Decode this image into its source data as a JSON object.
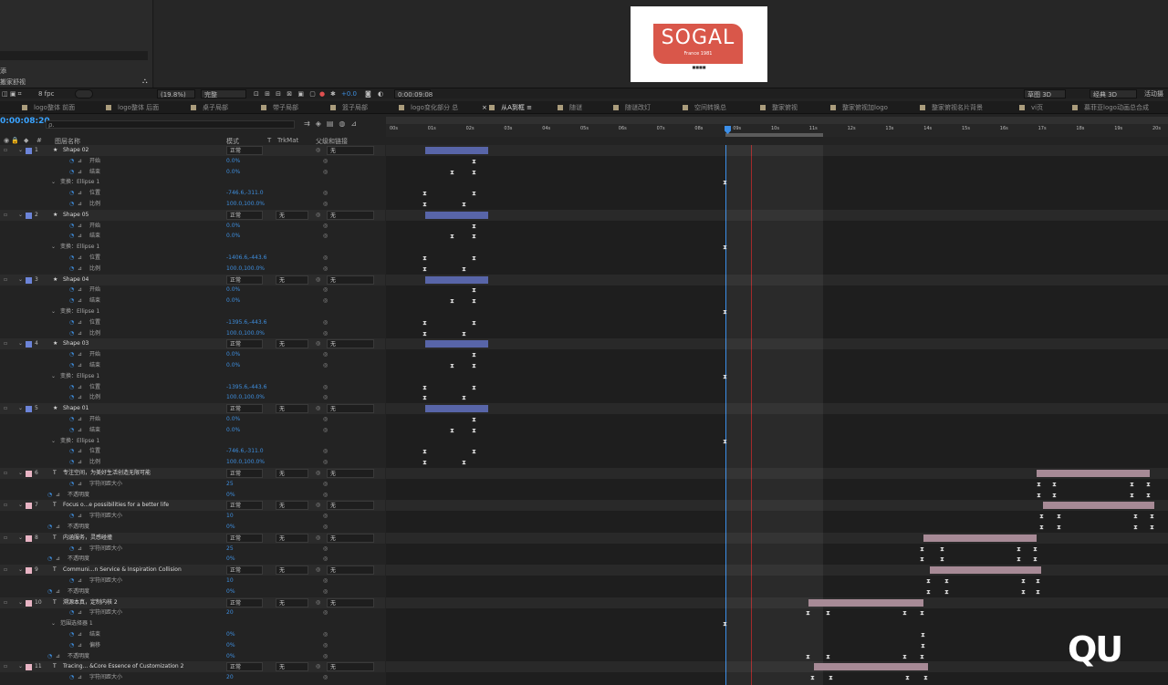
{
  "top_left": {
    "label1": "添",
    "label2": "搬家舒视"
  },
  "viewer": {
    "logo_main": "SOGAL",
    "logo_sub": "France 1981",
    "logo_tiny": "■■■■"
  },
  "controls": {
    "fps": "8 fpc",
    "zoom": "(19.8%)",
    "quality": "完整",
    "exposure": "+0.0",
    "timecode_small": "0:00:09:08",
    "render3d": "草图 3D",
    "mode": "经典 3D",
    "motion": "活动摄"
  },
  "tabs": [
    "logo整体 前面",
    "logo整体 后面",
    "桌子局部",
    "带子局部",
    "篮子局部",
    "logo变化部分 总",
    "从A到框",
    "随谜",
    "随谜改灯",
    "空间转换总",
    "整家俯视",
    "整家俯视加logo",
    "整家俯视名片背景",
    "vi页",
    "慕菲亚logo动画总合成"
  ],
  "active_tab": "从A到框",
  "timecode": "0:00:08:20",
  "columns": {
    "num": "#",
    "name": "图层名称",
    "mode": "模式",
    "t": "T",
    "trkmat": "TrkMat",
    "parent": "父级和链接"
  },
  "ruler_ticks": [
    "00s",
    "01s",
    "02s",
    "03s",
    "04s",
    "05s",
    "06s",
    "07s",
    "08s",
    "09s",
    "10s",
    "11s",
    "12s",
    "13s",
    "14s",
    "15s",
    "16s",
    "17s",
    "18s",
    "19s",
    "20s"
  ],
  "rows": [
    {
      "kind": "layer",
      "num": "1",
      "name": "Shape 02",
      "mode": "正常",
      "parent": "无",
      "color": "#6c84d8"
    },
    {
      "kind": "prop",
      "name": "开始",
      "value": "0.0%",
      "indent": 1
    },
    {
      "kind": "prop",
      "name": "结束",
      "value": "0.0%",
      "indent": 1
    },
    {
      "kind": "group",
      "name": "变换：Ellipse 1"
    },
    {
      "kind": "prop",
      "name": "位置",
      "value": "-746.6,-311.0",
      "indent": 1
    },
    {
      "kind": "prop",
      "name": "比例",
      "value": "100.0,100.0%",
      "indent": 1
    },
    {
      "kind": "layer",
      "num": "2",
      "name": "Shape 05",
      "mode": "正常",
      "trk": "无",
      "parent": "无",
      "color": "#6c84d8"
    },
    {
      "kind": "prop",
      "name": "开始",
      "value": "0.0%",
      "indent": 1
    },
    {
      "kind": "prop",
      "name": "结束",
      "value": "0.0%",
      "indent": 1
    },
    {
      "kind": "group",
      "name": "变换：Ellipse 1"
    },
    {
      "kind": "prop",
      "name": "位置",
      "value": "-1406.6,-443.6",
      "indent": 1
    },
    {
      "kind": "prop",
      "name": "比例",
      "value": "100.0,100.0%",
      "indent": 1
    },
    {
      "kind": "layer",
      "num": "3",
      "name": "Shape 04",
      "mode": "正常",
      "trk": "无",
      "parent": "无",
      "color": "#6c84d8"
    },
    {
      "kind": "prop",
      "name": "开始",
      "value": "0.0%",
      "indent": 1
    },
    {
      "kind": "prop",
      "name": "结束",
      "value": "0.0%",
      "indent": 1
    },
    {
      "kind": "group",
      "name": "变换：Ellipse 1"
    },
    {
      "kind": "prop",
      "name": "位置",
      "value": "-1395.6,-443.6",
      "indent": 1
    },
    {
      "kind": "prop",
      "name": "比例",
      "value": "100.0,100.0%",
      "indent": 1
    },
    {
      "kind": "layer",
      "num": "4",
      "name": "Shape 03",
      "mode": "正常",
      "trk": "无",
      "parent": "无",
      "color": "#6c84d8"
    },
    {
      "kind": "prop",
      "name": "开始",
      "value": "0.0%",
      "indent": 1
    },
    {
      "kind": "prop",
      "name": "结束",
      "value": "0.0%",
      "indent": 1
    },
    {
      "kind": "group",
      "name": "变换：Ellipse 1"
    },
    {
      "kind": "prop",
      "name": "位置",
      "value": "-1395.6,-443.6",
      "indent": 1
    },
    {
      "kind": "prop",
      "name": "比例",
      "value": "100.0,100.0%",
      "indent": 1
    },
    {
      "kind": "layer",
      "num": "5",
      "name": "Shape 01",
      "mode": "正常",
      "trk": "无",
      "parent": "无",
      "color": "#6c84d8"
    },
    {
      "kind": "prop",
      "name": "开始",
      "value": "0.0%",
      "indent": 1
    },
    {
      "kind": "prop",
      "name": "结束",
      "value": "0.0%",
      "indent": 1
    },
    {
      "kind": "group",
      "name": "变换：Ellipse 1"
    },
    {
      "kind": "prop",
      "name": "位置",
      "value": "-746.6,-311.0",
      "indent": 1
    },
    {
      "kind": "prop",
      "name": "比例",
      "value": "100.0,100.0%",
      "indent": 1
    },
    {
      "kind": "layer",
      "num": "6",
      "name": "专注空间，为美好生活创造无限可能",
      "mode": "正常",
      "trk": "无",
      "parent": "无",
      "color": "#e8b4c4",
      "text": true
    },
    {
      "kind": "prop",
      "name": "字符间距大小",
      "value": "25",
      "indent": 1
    },
    {
      "kind": "prop",
      "name": "不透明度",
      "value": "0%",
      "indent": 0
    },
    {
      "kind": "layer",
      "num": "7",
      "name": "Focus o...e possibilities for a better life",
      "mode": "正常",
      "trk": "无",
      "parent": "无",
      "color": "#e8b4c4",
      "text": true
    },
    {
      "kind": "prop",
      "name": "字符间距大小",
      "value": "10",
      "indent": 1
    },
    {
      "kind": "prop",
      "name": "不透明度",
      "value": "0%",
      "indent": 0
    },
    {
      "kind": "layer",
      "num": "8",
      "name": "内涵服务，灵感碰撞",
      "mode": "正常",
      "trk": "无",
      "parent": "无",
      "color": "#e8b4c4",
      "text": true
    },
    {
      "kind": "prop",
      "name": "字符间距大小",
      "value": "25",
      "indent": 1
    },
    {
      "kind": "prop",
      "name": "不透明度",
      "value": "0%",
      "indent": 0
    },
    {
      "kind": "layer",
      "num": "9",
      "name": "Communi...n Service & Inspiration Collision",
      "mode": "正常",
      "trk": "无",
      "parent": "无",
      "color": "#e8b4c4",
      "text": true
    },
    {
      "kind": "prop",
      "name": "字符间距大小",
      "value": "10",
      "indent": 1
    },
    {
      "kind": "prop",
      "name": "不透明度",
      "value": "0%",
      "indent": 0
    },
    {
      "kind": "layer",
      "num": "10",
      "name": "溯源本真，定制内核 2",
      "mode": "正常",
      "trk": "无",
      "parent": "无",
      "color": "#e8b4c4",
      "text": true
    },
    {
      "kind": "prop",
      "name": "字符间距大小",
      "value": "20",
      "indent": 1
    },
    {
      "kind": "group",
      "name": "范围选择器 1"
    },
    {
      "kind": "prop",
      "name": "结束",
      "value": "0%",
      "indent": 1
    },
    {
      "kind": "prop",
      "name": "偏移",
      "value": "0%",
      "indent": 1
    },
    {
      "kind": "prop",
      "name": "不透明度",
      "value": "0%",
      "indent": 0
    },
    {
      "kind": "layer",
      "num": "11",
      "name": "Tracing... &Core Essence of Customization 2",
      "mode": "正常",
      "trk": "无",
      "parent": "无",
      "color": "#e8b4c4",
      "text": true
    },
    {
      "kind": "prop",
      "name": "字符间距大小",
      "value": "20",
      "indent": 1
    }
  ],
  "tracks": [
    {
      "row": 0,
      "bar": [
        43,
        112
      ],
      "color": "#5865a8"
    },
    {
      "row": 1,
      "kf": [
        97
      ]
    },
    {
      "row": 2,
      "kf": [
        73,
        97
      ]
    },
    {
      "row": 3,
      "kf": [
        372
      ]
    },
    {
      "row": 4,
      "kf": [
        43,
        97
      ]
    },
    {
      "row": 5,
      "kf": [
        43,
        86
      ]
    },
    {
      "row": 6,
      "bar": [
        43,
        112
      ],
      "color": "#5865a8"
    },
    {
      "row": 7,
      "kf": [
        97
      ]
    },
    {
      "row": 8,
      "kf": [
        73,
        97
      ]
    },
    {
      "row": 9,
      "kf": [
        372
      ]
    },
    {
      "row": 10,
      "kf": [
        43,
        97
      ]
    },
    {
      "row": 11,
      "kf": [
        43,
        86
      ]
    },
    {
      "row": 12,
      "bar": [
        43,
        112
      ],
      "color": "#5865a8"
    },
    {
      "row": 13,
      "kf": [
        97
      ]
    },
    {
      "row": 14,
      "kf": [
        73,
        97
      ]
    },
    {
      "row": 15,
      "kf": [
        372
      ]
    },
    {
      "row": 16,
      "kf": [
        43,
        97
      ]
    },
    {
      "row": 17,
      "kf": [
        43,
        86
      ]
    },
    {
      "row": 18,
      "bar": [
        43,
        112
      ],
      "color": "#5865a8"
    },
    {
      "row": 19,
      "kf": [
        97
      ]
    },
    {
      "row": 20,
      "kf": [
        73,
        97
      ]
    },
    {
      "row": 21,
      "kf": [
        372
      ]
    },
    {
      "row": 22,
      "kf": [
        43,
        97
      ]
    },
    {
      "row": 23,
      "kf": [
        43,
        86
      ]
    },
    {
      "row": 24,
      "bar": [
        43,
        112
      ],
      "color": "#5865a8"
    },
    {
      "row": 25,
      "kf": [
        97
      ]
    },
    {
      "row": 26,
      "kf": [
        73,
        97
      ]
    },
    {
      "row": 27,
      "kf": [
        372
      ]
    },
    {
      "row": 28,
      "kf": [
        43,
        97
      ]
    },
    {
      "row": 29,
      "kf": [
        43,
        86
      ]
    },
    {
      "row": 30,
      "bar": [
        713,
        837
      ],
      "color": "#a78a96"
    },
    {
      "row": 31,
      "kf": [
        716,
        733,
        818,
        836
      ]
    },
    {
      "row": 32,
      "kf": [
        716,
        733,
        818,
        836
      ]
    },
    {
      "row": 33,
      "bar": [
        720,
        842
      ],
      "color": "#a78a96"
    },
    {
      "row": 34,
      "kf": [
        719,
        738,
        822,
        840
      ]
    },
    {
      "row": 35,
      "kf": [
        719,
        738,
        822,
        840
      ]
    },
    {
      "row": 36,
      "bar": [
        589,
        713
      ],
      "color": "#a78a96"
    },
    {
      "row": 37,
      "kf": [
        588,
        610,
        694,
        712
      ]
    },
    {
      "row": 38,
      "kf": [
        588,
        610,
        694,
        712
      ]
    },
    {
      "row": 39,
      "bar": [
        596,
        718
      ],
      "color": "#a78a96"
    },
    {
      "row": 40,
      "kf": [
        595,
        615,
        699,
        715
      ]
    },
    {
      "row": 41,
      "kf": [
        595,
        615,
        699,
        715
      ]
    },
    {
      "row": 42,
      "bar": [
        463,
        589
      ],
      "color": "#a78a96"
    },
    {
      "row": 43,
      "kf": [
        463,
        485,
        569,
        588
      ]
    },
    {
      "row": 44,
      "kf": [
        372
      ]
    },
    {
      "row": 45,
      "kf": [
        589
      ]
    },
    {
      "row": 46,
      "kf": [
        589
      ]
    },
    {
      "row": 47,
      "kf": [
        463,
        485,
        569,
        588
      ]
    },
    {
      "row": 48,
      "bar": [
        469,
        594
      ],
      "color": "#a78a96"
    },
    {
      "row": 49,
      "kf": [
        468,
        488,
        572,
        592
      ]
    }
  ]
}
